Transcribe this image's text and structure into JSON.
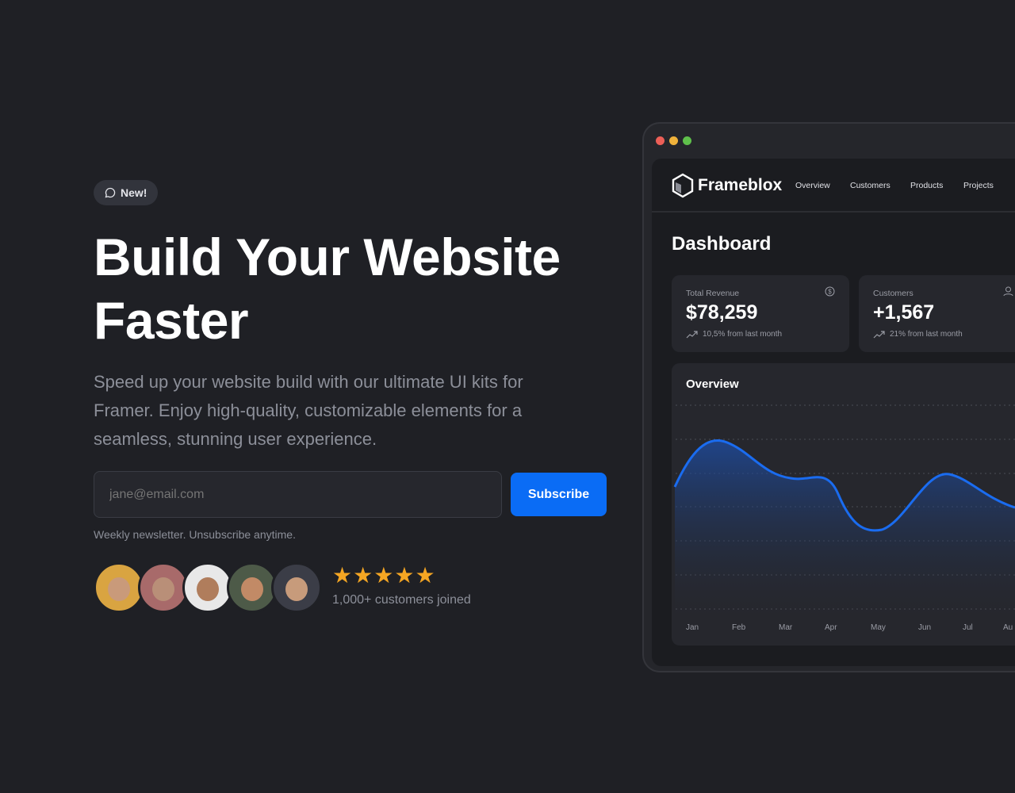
{
  "hero": {
    "badge": "New!",
    "title": "Build Your Website Faster",
    "subtitle": "Speed up your website build with our ultimate UI kits for Framer. Enjoy high-quality, customizable elements for a seamless, stunning user experience.",
    "email_placeholder": "jane@email.com",
    "subscribe": "Subscribe",
    "note": "Weekly newsletter. Unsubscribe anytime.",
    "rating": 5,
    "joined": "1,000+ customers joined",
    "accent": "#0a6cf5",
    "star_color": "#f5a623"
  },
  "dashboard": {
    "brand": "Frameblox",
    "nav": [
      "Overview",
      "Customers",
      "Products",
      "Projects"
    ],
    "title": "Dashboard",
    "cards": [
      {
        "label": "Total Revenue",
        "value": "$78,259",
        "change": "10,5% from last month",
        "icon": "dollar-icon"
      },
      {
        "label": "Customers",
        "value": "+1,567",
        "change": "21% from last month",
        "icon": "user-icon"
      }
    ],
    "overview": {
      "title": "Overview",
      "months": [
        "Jan",
        "Feb",
        "Mar",
        "Apr",
        "May",
        "Jun",
        "Jul",
        "Au"
      ]
    }
  }
}
